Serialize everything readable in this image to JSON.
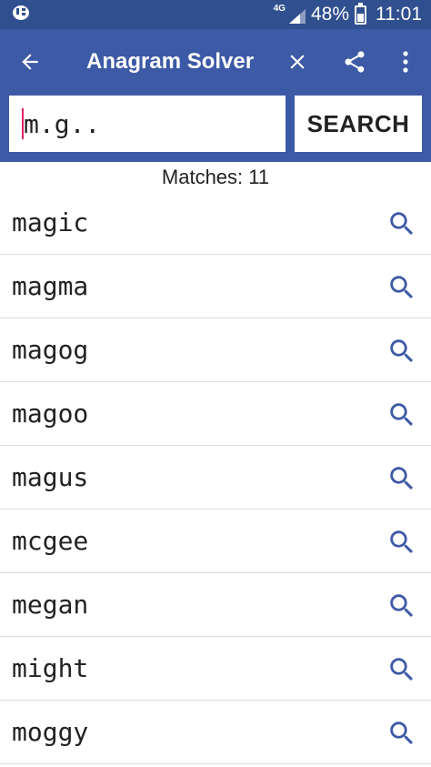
{
  "status_bar": {
    "network": "4G",
    "battery": "48%",
    "battery_level": 0.48,
    "time": "11:01"
  },
  "toolbar": {
    "title": "Anagram Solver"
  },
  "search": {
    "value": "m.g..",
    "button_label": "SEARCH"
  },
  "matches": {
    "label": "Matches: 11"
  },
  "results": [
    "magic",
    "magma",
    "magog",
    "magoo",
    "magus",
    "mcgee",
    "megan",
    "might",
    "moggy"
  ],
  "colors": {
    "status_bar": "#2f4f8f",
    "app_bar": "#3d5aa6",
    "icon_accent": "#3d5aa6"
  },
  "icons": {
    "back": "arrow-left-icon",
    "close": "close-icon",
    "share": "share-icon",
    "more": "more-vertical-icon",
    "row_search": "search-icon"
  }
}
